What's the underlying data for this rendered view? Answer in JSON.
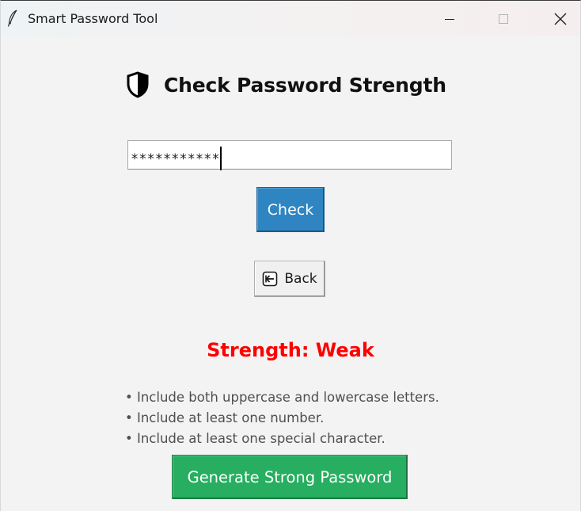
{
  "window": {
    "title": "Smart Password Tool",
    "app_icon": "feather-icon",
    "controls": [
      "minimize-icon",
      "maximize-icon",
      "close-icon"
    ]
  },
  "main": {
    "heading_icon": "shield-icon",
    "heading": "Check Password Strength",
    "password_input": {
      "value": "***********",
      "masked": true
    },
    "check_label": "Check",
    "back_icon": "back-arrow-icon",
    "back_label": "Back",
    "strength_text": "Strength: Weak",
    "tips": [
      "• Include both uppercase and lowercase letters.",
      "• Include at least one number.",
      "• Include at least one special character."
    ],
    "generate_label": "Generate Strong Password"
  },
  "colors": {
    "check_button": "#2f85c2",
    "generate_button": "#27ae60",
    "strength_weak": "#ff0000",
    "window_background": "#f3f3f3"
  }
}
